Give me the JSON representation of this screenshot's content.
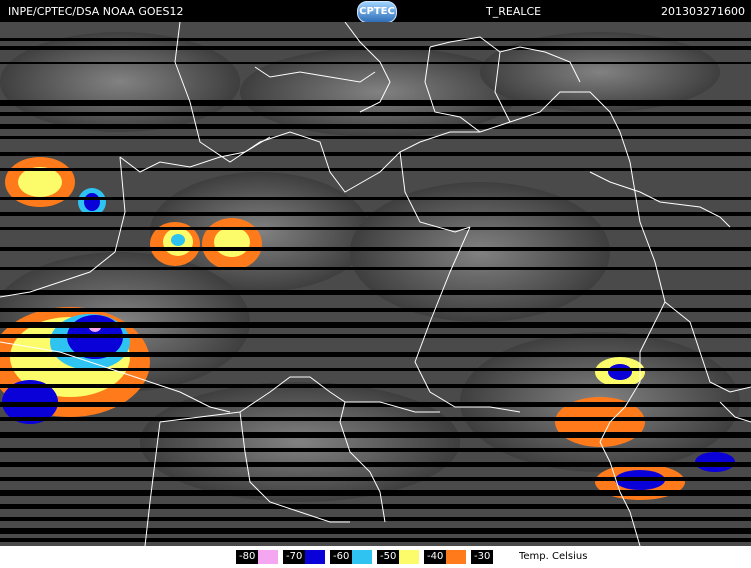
{
  "header": {
    "source": "INPE/CPTEC/DSA NOAA GOES12",
    "product": "T_REALCE",
    "timestamp": "201303271600",
    "logo_text": "CPTEC"
  },
  "legend": {
    "unit_label": "Temp. Celsius",
    "entries": [
      {
        "value": "-80",
        "color": "#f4a6f0"
      },
      {
        "value": "-70",
        "color": "#0a00d8"
      },
      {
        "value": "-60",
        "color": "#2fc3f2"
      },
      {
        "value": "-50",
        "color": "#fcfc6a"
      },
      {
        "value": "-40",
        "color": "#ff7a1a"
      },
      {
        "value": "-30",
        "color": "#ff7a1a"
      }
    ]
  },
  "colors": {
    "cloud_gray": "#6a6a6a",
    "boundary": "#ffffff",
    "scanline": "#000000"
  }
}
